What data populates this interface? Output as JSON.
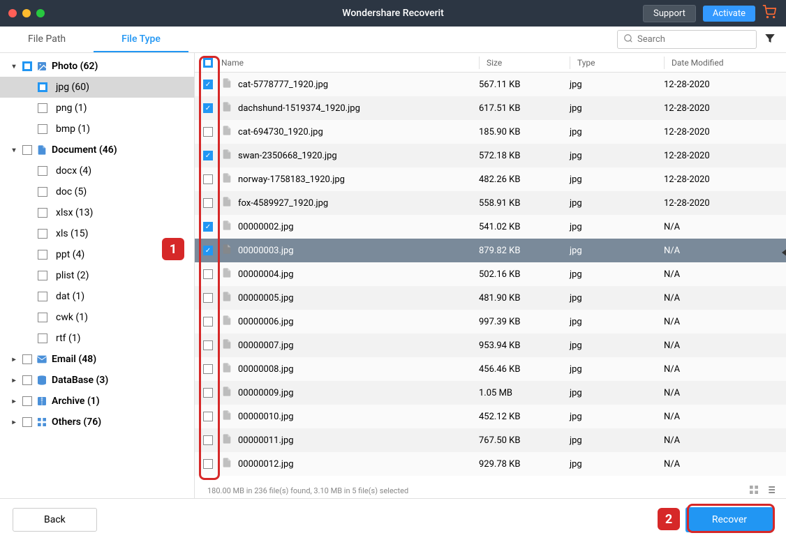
{
  "app_title": "Wondershare Recoverit",
  "titlebar": {
    "support": "Support",
    "activate": "Activate"
  },
  "tabs": {
    "file_path": "File Path",
    "file_type": "File Type"
  },
  "search": {
    "placeholder": "Search"
  },
  "sidebar": {
    "categories": [
      {
        "label": "Photo (62)",
        "icon": "image",
        "expanded": true,
        "check": "partial",
        "children": [
          {
            "label": "jpg (60)",
            "check": "partial",
            "selected": true
          },
          {
            "label": "png (1)",
            "check": "none"
          },
          {
            "label": "bmp (1)",
            "check": "none"
          }
        ]
      },
      {
        "label": "Document (46)",
        "icon": "document",
        "expanded": true,
        "check": "none",
        "children": [
          {
            "label": "docx (4)"
          },
          {
            "label": "doc (5)"
          },
          {
            "label": "xlsx (13)"
          },
          {
            "label": "xls (15)"
          },
          {
            "label": "ppt (4)"
          },
          {
            "label": "plist (2)"
          },
          {
            "label": "dat (1)"
          },
          {
            "label": "cwk (1)"
          },
          {
            "label": "rtf (1)"
          }
        ]
      },
      {
        "label": "Email (48)",
        "icon": "email",
        "expanded": false
      },
      {
        "label": "DataBase (3)",
        "icon": "database",
        "expanded": false
      },
      {
        "label": "Archive (1)",
        "icon": "archive",
        "expanded": false
      },
      {
        "label": "Others (76)",
        "icon": "others",
        "expanded": false
      }
    ]
  },
  "table": {
    "headers": {
      "name": "Name",
      "size": "Size",
      "type": "Type",
      "date": "Date Modified"
    },
    "header_check": "partial",
    "rows": [
      {
        "checked": true,
        "name": "cat-5778777_1920.jpg",
        "size": "567.11 KB",
        "type": "jpg",
        "date": "12-28-2020"
      },
      {
        "checked": true,
        "name": "dachshund-1519374_1920.jpg",
        "size": "617.51 KB",
        "type": "jpg",
        "date": "12-28-2020"
      },
      {
        "checked": false,
        "name": "cat-694730_1920.jpg",
        "size": "185.90 KB",
        "type": "jpg",
        "date": "12-28-2020"
      },
      {
        "checked": true,
        "name": "swan-2350668_1920.jpg",
        "size": "572.18 KB",
        "type": "jpg",
        "date": "12-28-2020"
      },
      {
        "checked": false,
        "name": "norway-1758183_1920.jpg",
        "size": "482.26 KB",
        "type": "jpg",
        "date": "12-28-2020"
      },
      {
        "checked": false,
        "name": "fox-4589927_1920.jpg",
        "size": "558.91 KB",
        "type": "jpg",
        "date": "12-28-2020"
      },
      {
        "checked": true,
        "name": "00000002.jpg",
        "size": "541.02 KB",
        "type": "jpg",
        "date": "N/A"
      },
      {
        "checked": true,
        "name": "00000003.jpg",
        "size": "879.82 KB",
        "type": "jpg",
        "date": "N/A",
        "selected": true
      },
      {
        "checked": false,
        "name": "00000004.jpg",
        "size": "502.16 KB",
        "type": "jpg",
        "date": "N/A"
      },
      {
        "checked": false,
        "name": "00000005.jpg",
        "size": "481.90 KB",
        "type": "jpg",
        "date": "N/A"
      },
      {
        "checked": false,
        "name": "00000006.jpg",
        "size": "997.39 KB",
        "type": "jpg",
        "date": "N/A"
      },
      {
        "checked": false,
        "name": "00000007.jpg",
        "size": "953.94 KB",
        "type": "jpg",
        "date": "N/A"
      },
      {
        "checked": false,
        "name": "00000008.jpg",
        "size": "456.46 KB",
        "type": "jpg",
        "date": "N/A"
      },
      {
        "checked": false,
        "name": "00000009.jpg",
        "size": "1.05 MB",
        "type": "jpg",
        "date": "N/A"
      },
      {
        "checked": false,
        "name": "00000010.jpg",
        "size": "452.12 KB",
        "type": "jpg",
        "date": "N/A"
      },
      {
        "checked": false,
        "name": "00000011.jpg",
        "size": "767.50 KB",
        "type": "jpg",
        "date": "N/A"
      },
      {
        "checked": false,
        "name": "00000012.jpg",
        "size": "929.78 KB",
        "type": "jpg",
        "date": "N/A"
      }
    ]
  },
  "status": "180.00 MB in 236 file(s) found, 3.10 MB in 5 file(s) selected",
  "footer": {
    "back": "Back",
    "recover": "Recover"
  },
  "annotations": {
    "one": "1",
    "two": "2"
  }
}
